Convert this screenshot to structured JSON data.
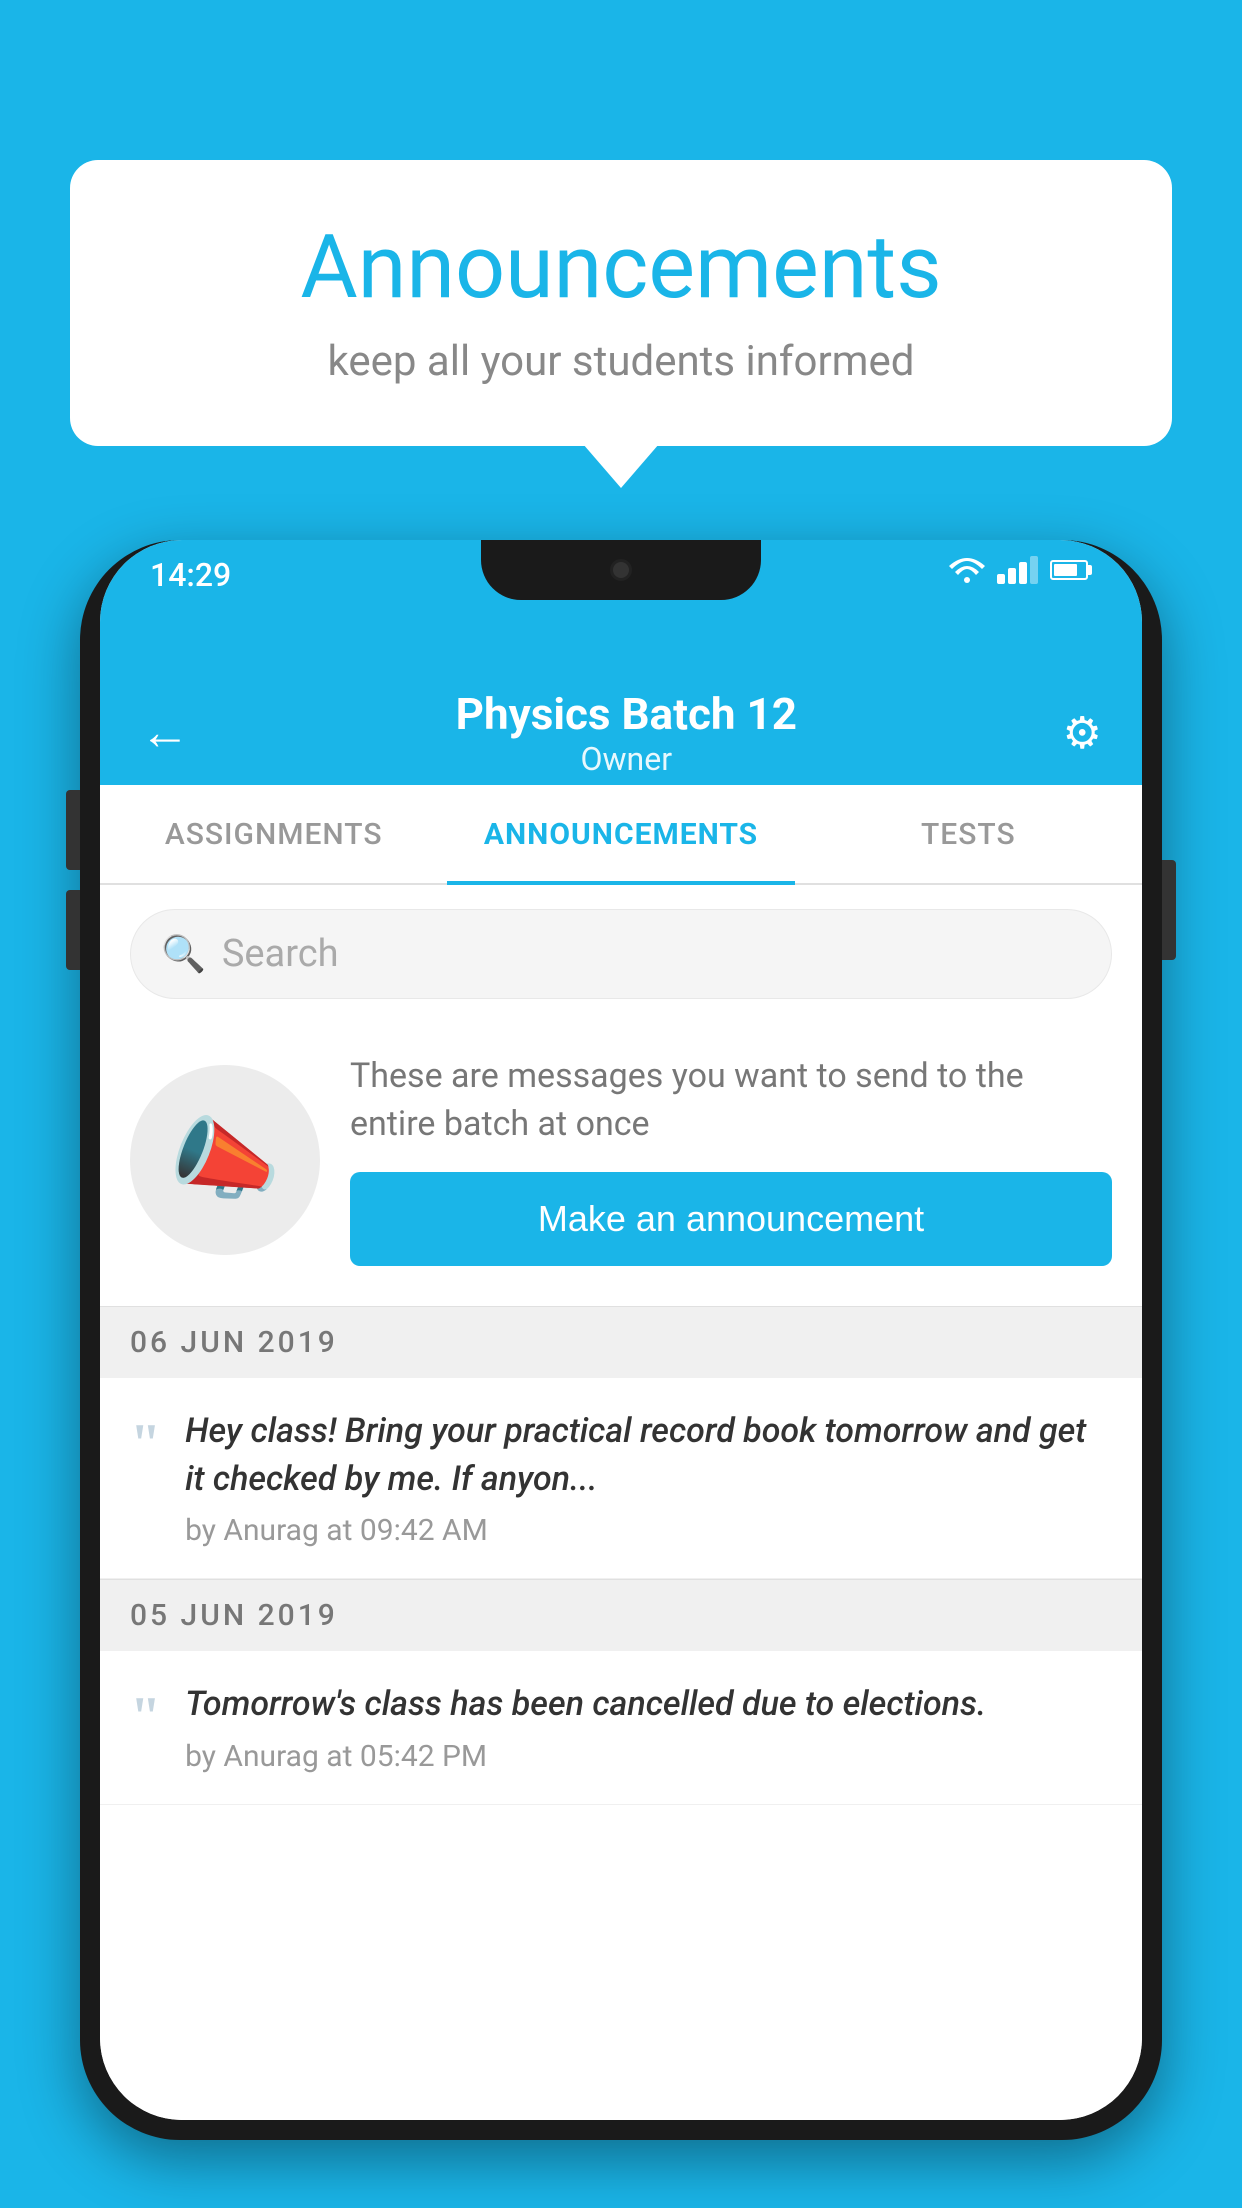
{
  "background_color": "#1ab5e8",
  "speech_bubble": {
    "title": "Announcements",
    "subtitle": "keep all your students informed",
    "title_color": "#1ab5e8",
    "subtitle_color": "#888888"
  },
  "status_bar": {
    "time": "14:29"
  },
  "header": {
    "title": "Physics Batch 12",
    "subtitle": "Owner",
    "back_label": "←",
    "settings_label": "⚙"
  },
  "tabs": [
    {
      "label": "ASSIGNMENTS",
      "active": false
    },
    {
      "label": "ANNOUNCEMENTS",
      "active": true
    },
    {
      "label": "TESTS",
      "active": false
    }
  ],
  "search": {
    "placeholder": "Search"
  },
  "announcement_prompt": {
    "description": "These are messages you want to send to the entire batch at once",
    "button_label": "Make an announcement"
  },
  "announcements": [
    {
      "date": "06  JUN  2019",
      "text": "Hey class! Bring your practical record book tomorrow and get it checked by me. If anyon...",
      "meta": "by Anurag at 09:42 AM"
    },
    {
      "date": "05  JUN  2019",
      "text": "Tomorrow's class has been cancelled due to elections.",
      "meta": "by Anurag at 05:42 PM"
    }
  ]
}
